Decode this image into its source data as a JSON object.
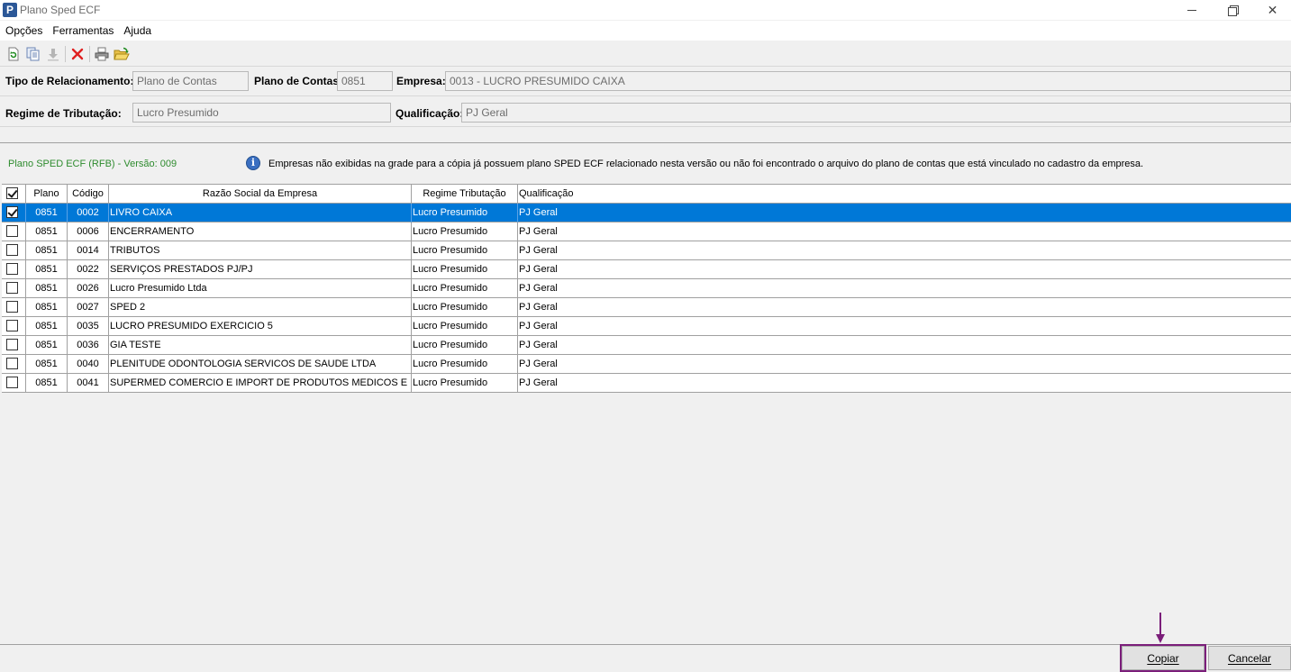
{
  "window": {
    "title": "Plano Sped ECF",
    "app_icon": "P"
  },
  "menu": [
    "Opções",
    "Ferramentas",
    "Ajuda"
  ],
  "toolbar": [
    "refresh-icon",
    "copy-icon",
    "download-icon",
    "delete-icon",
    "print-icon",
    "open-folder-icon"
  ],
  "form": {
    "tipo_label": "Tipo de Relacionamento:",
    "tipo_value": "Plano de Contas",
    "plano_label": "Plano de Contas:",
    "plano_value": "0851",
    "empresa_label": "Empresa:",
    "empresa_value": "0013 - LUCRO PRESUMIDO CAIXA",
    "regime_label": "Regime de Tributação:",
    "regime_value": "Lucro Presumido",
    "qualificacao_label": "Qualificação:",
    "qualificacao_value": "PJ Geral"
  },
  "info": {
    "version": "Plano SPED ECF (RFB) - Versão: 009",
    "message": "Empresas não exibidas na grade para a cópia já possuem plano SPED ECF relacionado nesta versão ou não foi encontrado o arquivo do plano de contas que está vinculado no cadastro da empresa."
  },
  "grid": {
    "headers": {
      "plano": "Plano",
      "codigo": "Código",
      "razao": "Razão Social da Empresa",
      "regime": "Regime Tributação",
      "qualificacao": "Qualificação"
    },
    "header_checked": true,
    "rows": [
      {
        "checked": true,
        "selected": true,
        "plano": "0851",
        "codigo": "0002",
        "razao": "LIVRO CAIXA",
        "regime": "Lucro Presumido",
        "qualificacao": "PJ Geral"
      },
      {
        "checked": false,
        "selected": false,
        "plano": "0851",
        "codigo": "0006",
        "razao": "ENCERRAMENTO",
        "regime": "Lucro Presumido",
        "qualificacao": "PJ Geral"
      },
      {
        "checked": false,
        "selected": false,
        "plano": "0851",
        "codigo": "0014",
        "razao": "TRIBUTOS",
        "regime": "Lucro Presumido",
        "qualificacao": "PJ Geral"
      },
      {
        "checked": false,
        "selected": false,
        "plano": "0851",
        "codigo": "0022",
        "razao": "SERVIÇOS PRESTADOS PJ/PJ",
        "regime": "Lucro Presumido",
        "qualificacao": "PJ Geral"
      },
      {
        "checked": false,
        "selected": false,
        "plano": "0851",
        "codigo": "0026",
        "razao": "Lucro Presumido Ltda",
        "regime": "Lucro Presumido",
        "qualificacao": "PJ Geral"
      },
      {
        "checked": false,
        "selected": false,
        "plano": "0851",
        "codigo": "0027",
        "razao": "SPED 2",
        "regime": "Lucro Presumido",
        "qualificacao": "PJ Geral"
      },
      {
        "checked": false,
        "selected": false,
        "plano": "0851",
        "codigo": "0035",
        "razao": "LUCRO PRESUMIDO EXERCICIO 5",
        "regime": "Lucro Presumido",
        "qualificacao": "PJ Geral"
      },
      {
        "checked": false,
        "selected": false,
        "plano": "0851",
        "codigo": "0036",
        "razao": "GIA TESTE",
        "regime": "Lucro Presumido",
        "qualificacao": "PJ Geral"
      },
      {
        "checked": false,
        "selected": false,
        "plano": "0851",
        "codigo": "0040",
        "razao": "PLENITUDE ODONTOLOGIA SERVICOS DE SAUDE LTDA",
        "regime": "Lucro Presumido",
        "qualificacao": "PJ Geral"
      },
      {
        "checked": false,
        "selected": false,
        "plano": "0851",
        "codigo": "0041",
        "razao": "SUPERMED COMERCIO E IMPORT DE PRODUTOS MEDICOS E HOSP L",
        "regime": "Lucro Presumido",
        "qualificacao": "PJ Geral"
      }
    ]
  },
  "buttons": {
    "copiar": "Copiar",
    "cancelar": "Cancelar"
  },
  "colors": {
    "selection": "#0078d7",
    "highlight_outline": "#7b1e7a",
    "version_text": "#2e8b2e"
  }
}
